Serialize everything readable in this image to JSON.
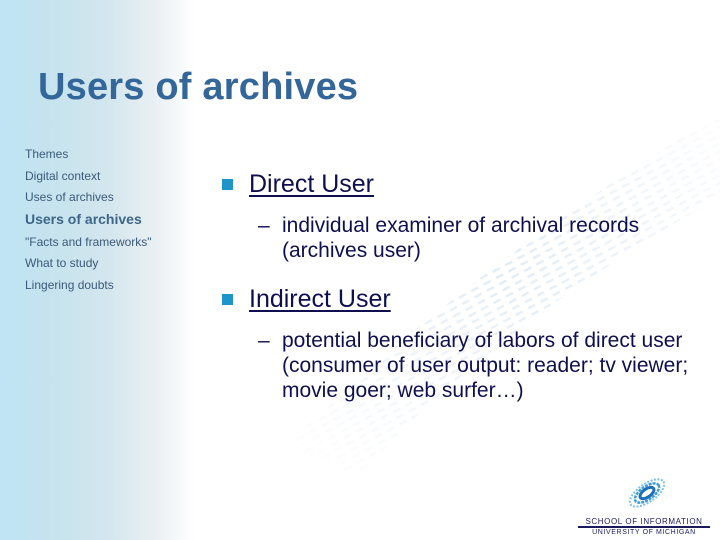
{
  "slide": {
    "title": "Users of archives",
    "colors": {
      "title": "#336699",
      "body_text": "#0f0f4f",
      "bullet": "#1e95c8",
      "sidebar_gradient_start": "#bfe4f4"
    }
  },
  "sidebar": {
    "items": [
      {
        "label": "Themes",
        "active": false
      },
      {
        "label": "Digital context",
        "active": false
      },
      {
        "label": "Uses of archives",
        "active": false
      },
      {
        "label": "Users of archives",
        "active": true
      },
      {
        "label": "\"Facts and frameworks\"",
        "active": false
      },
      {
        "label": "What to study",
        "active": false
      },
      {
        "label": "Lingering doubts",
        "active": false
      }
    ]
  },
  "content": {
    "bullets": [
      {
        "label": "Direct User",
        "icon": "square-bullet-icon",
        "subitems": [
          {
            "dash": "–",
            "text": "individual examiner of archival records (archives user)"
          }
        ]
      },
      {
        "label": "Indirect User",
        "icon": "square-bullet-icon",
        "subitems": [
          {
            "dash": "–",
            "text": "potential beneficiary of labors of direct user (consumer of user output: reader; tv viewer; movie goer; web surfer…)"
          }
        ]
      }
    ]
  },
  "logo": {
    "icon": "galaxy-spiral-icon",
    "line1": "SCHOOL OF INFORMATION",
    "line2": "UNIVERSITY OF MICHIGAN"
  }
}
